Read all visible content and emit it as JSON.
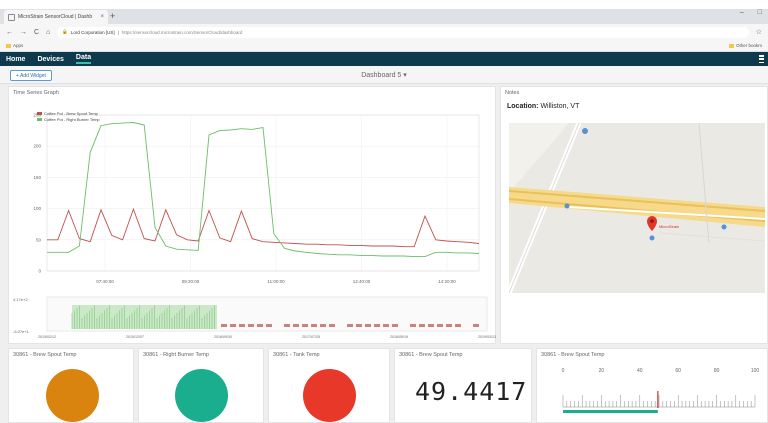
{
  "browser": {
    "tab_title": "MicroStrain SensorCloud | Dashb",
    "tab_close": "×",
    "new_tab": "+",
    "window_buttons": [
      "–",
      "□"
    ],
    "nav": {
      "back": "←",
      "forward": "→",
      "reload": "C",
      "home": "⌂"
    },
    "secure_label": "Lord Corporation [US]",
    "url": "https://sensorcloud.microstrain.com/SensorCloud/dashboard",
    "star": "☆",
    "apps_label": "Apps",
    "other_bookmarks": "Other bookm"
  },
  "app": {
    "nav_items": [
      "Home",
      "Devices",
      "Data"
    ],
    "add_widget_label": "+ Add Widget",
    "dashboard_title": "Dashboard 5 ▾"
  },
  "time_series": {
    "title": "Time Series Graph"
  },
  "chart_data": {
    "type": "line",
    "title": "",
    "series": [
      {
        "name": "Coffee Pot - Brew Spout Temp",
        "color": "#c0504d",
        "values": [
          50,
          50,
          97,
          52,
          47,
          98,
          57,
          50,
          99,
          52,
          48,
          98,
          58,
          50,
          48,
          97,
          53,
          47,
          96,
          52,
          47,
          46,
          45,
          44,
          43,
          43,
          42,
          42,
          41,
          41,
          40,
          40,
          40,
          39,
          39,
          88,
          50,
          48,
          47,
          46,
          44
        ]
      },
      {
        "name": "Coffee Pot - Right Burner Temp",
        "color": "#6abf69",
        "values": [
          30,
          30,
          30,
          40,
          190,
          233,
          236,
          237,
          238,
          234,
          70,
          40,
          35,
          34,
          33,
          218,
          225,
          226,
          228,
          227,
          230,
          60,
          36,
          32,
          30,
          28,
          27,
          26,
          26,
          25,
          25,
          24,
          24,
          24,
          23,
          23,
          30,
          30,
          29,
          29,
          28
        ]
      }
    ],
    "x_ticks": [
      "07:40:00",
      "09:20:00",
      "11:00:00",
      "12:40:00",
      "14:20:00"
    ],
    "y_ticks": [
      "250",
      "200",
      "150",
      "100",
      "50",
      "0"
    ],
    "ylim": [
      0,
      250
    ],
    "grid": true,
    "legend_position": "top-left",
    "overview": {
      "y_ticks": [
        "4.17e+2",
        "-6.07e+1"
      ],
      "x_ticks": [
        "2015/02/12",
        "2015/12/07",
        "2016/09/30",
        "2017/07/25",
        "2018/05/19",
        "2019/03/13"
      ]
    }
  },
  "notes": {
    "title": "Notes",
    "location_label": "Location:",
    "location_value": "Williston, VT",
    "marker_label": "MicroStrain"
  },
  "widgets": [
    {
      "title": "30861 - Brew Spout Temp",
      "type": "status",
      "color": "#d9840f"
    },
    {
      "title": "30861 - Right Burner Temp",
      "type": "status",
      "color": "#1aae8e"
    },
    {
      "title": "30861 - Tank Temp",
      "type": "status",
      "color": "#e8382a"
    },
    {
      "title": "30861 - Brew Spout Temp",
      "type": "value",
      "value": "49.4417"
    },
    {
      "title": "30861 - Brew Spout Temp",
      "type": "gauge",
      "ticks": [
        "0",
        "20",
        "40",
        "60",
        "80",
        "100"
      ],
      "value": 49.4
    }
  ]
}
